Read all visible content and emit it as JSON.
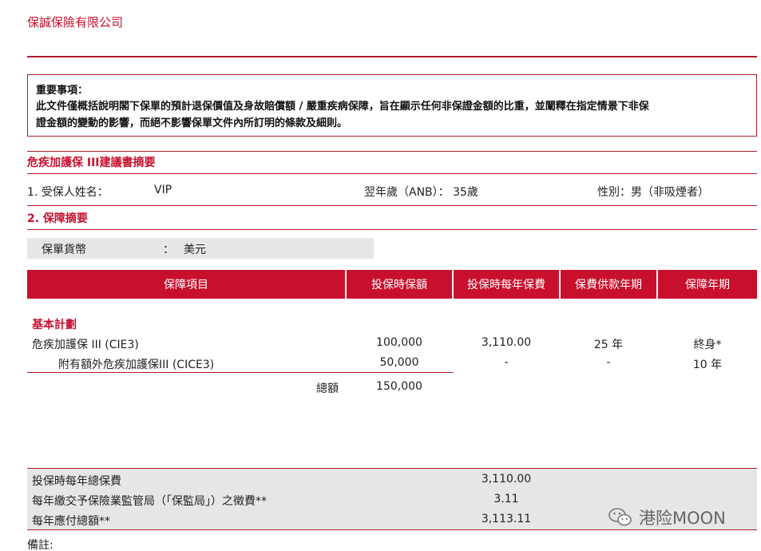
{
  "company": "保誠保險有限公司",
  "notice": {
    "heading": "重要事項：",
    "line1": "此文件僅概括說明閣下保單的預計退保價值及身故賠償額 / 嚴重疾病保障，旨在顯示任何非保證金額的比重，並闡釋在指定情景下非保",
    "line2": "證金額的變動的影響，而絕不影響保單文件內所訂明的條款及細則。"
  },
  "proposal_title": "危疾加護保 III建議書摘要",
  "insured": {
    "name_label": "1. 受保人姓名：",
    "name_value": "VIP",
    "age": "翌年歲（ANB）： 35歲",
    "gender": "性別：男（非吸煙者）"
  },
  "section2_title": "2. 保障摘要",
  "currency": {
    "label": "保單貨幣",
    "colon": "：",
    "value": "美元"
  },
  "table": {
    "headers": [
      "保障項目",
      "投保時保額",
      "投保時每年保費",
      "保費供款年期",
      "保障年期"
    ],
    "group_title": "基本計劃",
    "rows": [
      {
        "item": "危疾加護保 III (CIE3)",
        "sum": "100,000",
        "premium": "3,110.00",
        "term": "25 年",
        "coverage": "終身*"
      },
      {
        "item": "附有額外危疾加護保III (CICE3)",
        "sum": "50,000",
        "premium": "-",
        "term": "-",
        "coverage": "10 年"
      }
    ],
    "total_label": "總額",
    "total_value": "150,000"
  },
  "summary": [
    {
      "label": "投保時每年總保費",
      "value": "3,110.00"
    },
    {
      "label": "每年繳交予保險業監管局（「保監局」）之徵費**",
      "value": "3.11"
    },
    {
      "label": "每年應付總額**",
      "value": "3,113.11"
    }
  ],
  "remarks": "備註:",
  "watermark": "港险MOON",
  "colors": {
    "accent": "#c8102e",
    "panel": "#e6e6e6"
  }
}
